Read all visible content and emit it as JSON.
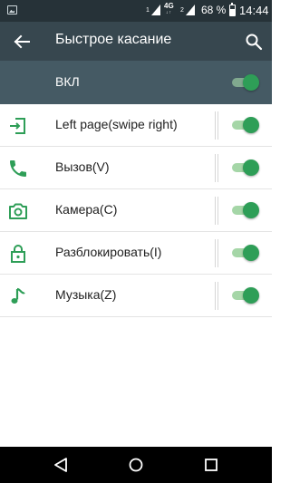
{
  "status_bar": {
    "sim1_label": "1",
    "sim2_label": "2",
    "network_type": "4G",
    "network_arrows": "↓↑",
    "battery_percent": "68 %",
    "battery_level": 0.68,
    "time": "14:44"
  },
  "toolbar": {
    "title": "Быстрое касание",
    "back_icon": "arrow-back-icon",
    "search_icon": "search-icon"
  },
  "master_switch": {
    "label": "ВКЛ",
    "enabled": true
  },
  "gestures": [
    {
      "label": "Left page(swipe right)",
      "icon": "enter-page-icon",
      "enabled": true
    },
    {
      "label": "Вызов(V)",
      "icon": "phone-icon",
      "enabled": true
    },
    {
      "label": "Камера(C)",
      "icon": "camera-icon",
      "enabled": true
    },
    {
      "label": "Разблокировать(I)",
      "icon": "unlock-icon",
      "enabled": true
    },
    {
      "label": "Музыка(Z)",
      "icon": "music-note-icon",
      "enabled": true
    }
  ],
  "colors": {
    "status_bar": "#263238",
    "toolbar": "#37474f",
    "master_row": "#455a64",
    "accent_green": "#2e9e57",
    "track_green": "#a5d6a7"
  },
  "nav_bar": {
    "back": "nav-back-icon",
    "home": "nav-home-icon",
    "recent": "nav-recent-icon"
  }
}
